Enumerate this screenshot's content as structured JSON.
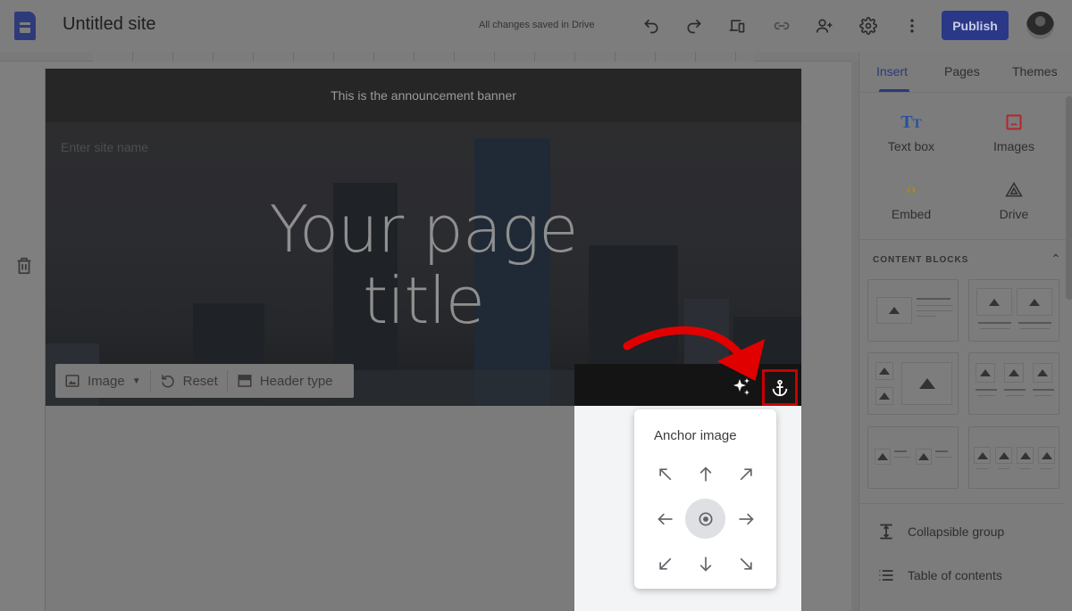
{
  "app": {
    "title": "Untitled site",
    "save_status": "All changes saved in Drive",
    "publish_label": "Publish",
    "toolbar_icons": [
      "undo-icon",
      "redo-icon",
      "preview-devices-icon",
      "copy-link-icon",
      "share-add-person-icon",
      "settings-gear-icon",
      "more-vert-icon"
    ]
  },
  "canvas": {
    "announcement_banner": "This is the announcement banner",
    "site_name_placeholder": "Enter site name",
    "page_title_line1": "Your page",
    "page_title_line2": "title",
    "hero_toolbar": {
      "image_label": "Image",
      "reset_label": "Reset",
      "header_type_label": "Header type"
    }
  },
  "anchor_popup": {
    "title": "Anchor image",
    "directions": [
      "top-left",
      "top",
      "top-right",
      "left",
      "center",
      "right",
      "bottom-left",
      "bottom",
      "bottom-right"
    ],
    "selected": "center"
  },
  "right_panel": {
    "tabs": [
      {
        "label": "Insert",
        "active": true
      },
      {
        "label": "Pages",
        "active": false
      },
      {
        "label": "Themes",
        "active": false
      }
    ],
    "insert_items": [
      {
        "label": "Text box",
        "icon": "text-box-icon",
        "color": "#2a4fa0"
      },
      {
        "label": "Images",
        "icon": "image-icon",
        "color": "#b3262a"
      },
      {
        "label": "Embed",
        "icon": "embed-code-icon",
        "color": "#b08a10"
      },
      {
        "label": "Drive",
        "icon": "drive-icon",
        "color": "#333333"
      }
    ],
    "content_blocks_header": "CONTENT BLOCKS",
    "list_items": [
      {
        "label": "Collapsible group",
        "icon": "collapsible-icon"
      },
      {
        "label": "Table of contents",
        "icon": "toc-list-icon"
      }
    ]
  },
  "colors": {
    "publish_bg": "#2b3887",
    "annotation_red": "#e00000"
  }
}
